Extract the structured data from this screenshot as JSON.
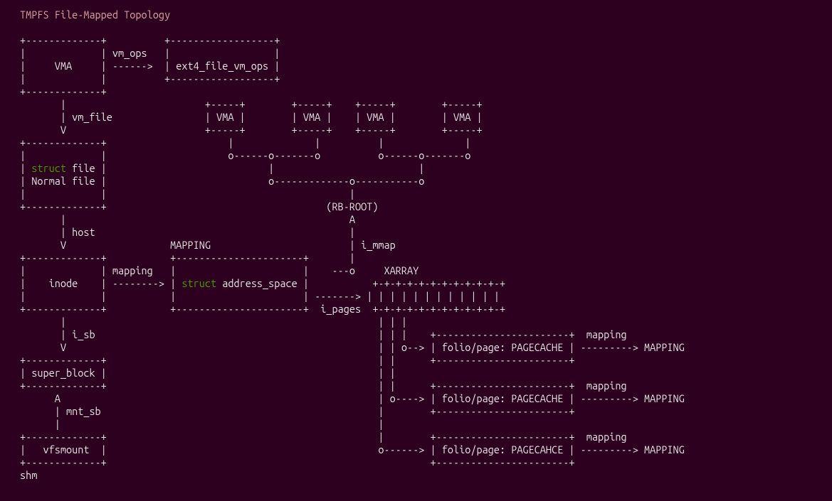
{
  "title": "TMPFS File-Mapped Topology",
  "chart_data": {
    "type": "diagram",
    "title": "TMPFS File-Mapped Topology",
    "nodes": [
      {
        "id": "VMA0",
        "label": "VMA"
      },
      {
        "id": "ext4_file_vm_ops",
        "label": "ext4_file_vm_ops"
      },
      {
        "id": "VMA1",
        "label": "VMA"
      },
      {
        "id": "VMA2",
        "label": "VMA"
      },
      {
        "id": "VMA3",
        "label": "VMA"
      },
      {
        "id": "VMA4",
        "label": "VMA"
      },
      {
        "id": "struct_file",
        "label": "struct file / Normal file"
      },
      {
        "id": "RB_ROOT",
        "label": "(RB-ROOT)"
      },
      {
        "id": "inode",
        "label": "inode"
      },
      {
        "id": "address_space",
        "label": "struct address_space",
        "annotation": "MAPPING"
      },
      {
        "id": "XARRAY",
        "label": "XARRAY"
      },
      {
        "id": "super_block",
        "label": "super_block"
      },
      {
        "id": "vfsmount",
        "label": "vfsmount"
      },
      {
        "id": "shm",
        "label": "shm"
      },
      {
        "id": "folio1",
        "label": "folio/page: PAGECACHE"
      },
      {
        "id": "folio2",
        "label": "folio/page: PAGECACHE"
      },
      {
        "id": "folio3",
        "label": "folio/page: PAGECAHCE"
      }
    ],
    "edges": [
      {
        "from": "VMA0",
        "to": "ext4_file_vm_ops",
        "label": "vm_ops"
      },
      {
        "from": "VMA0",
        "to": "struct_file",
        "label": "vm_file"
      },
      {
        "from": "VMA1",
        "to": "RB_ROOT",
        "label": ""
      },
      {
        "from": "VMA2",
        "to": "RB_ROOT",
        "label": ""
      },
      {
        "from": "VMA3",
        "to": "RB_ROOT",
        "label": ""
      },
      {
        "from": "VMA4",
        "to": "RB_ROOT",
        "label": ""
      },
      {
        "from": "struct_file",
        "to": "inode",
        "label": "host"
      },
      {
        "from": "inode",
        "to": "address_space",
        "label": "mapping"
      },
      {
        "from": "address_space",
        "to": "RB_ROOT",
        "label": "i_mmap"
      },
      {
        "from": "address_space",
        "to": "XARRAY",
        "label": "i_pages"
      },
      {
        "from": "inode",
        "to": "super_block",
        "label": "i_sb"
      },
      {
        "from": "vfsmount",
        "to": "super_block",
        "label": "mnt_sb"
      },
      {
        "from": "XARRAY",
        "to": "folio1",
        "label": ""
      },
      {
        "from": "XARRAY",
        "to": "folio2",
        "label": ""
      },
      {
        "from": "XARRAY",
        "to": "folio3",
        "label": ""
      },
      {
        "from": "folio1",
        "to": "address_space",
        "label": "mapping -> MAPPING"
      },
      {
        "from": "folio2",
        "to": "address_space",
        "label": "mapping -> MAPPING"
      },
      {
        "from": "folio3",
        "to": "address_space",
        "label": "mapping -> MAPPING"
      }
    ],
    "footer": "shm",
    "keyword": "struct"
  },
  "kw": "struct",
  "lines": {
    "l00": "+-------------+          +------------------+",
    "l01": "|             | vm_ops   |                  |",
    "l02a": "|     VMA     | ------>  | ext4_file_vm_ops |",
    "l03": "|             |          +------------------+",
    "l04": "+-------------+",
    "l05": "       |                        +-----+        +-----+    +-----+        +-----+",
    "l06": "       | vm_file                | VMA |        | VMA |    | VMA |        | VMA |",
    "l07": "       V                        +-----+        +-----+    +-----+        +-----+",
    "l08": "+-------------+                     |              |          |              |",
    "l09": "|             |                     o------o-------o          o------o-------o",
    "l10a": " file |                            |                         |",
    "l11": "| Normal file |                            o-------------o-----------o",
    "l12": "|             |                                          |",
    "l13": "+-------------+                                      (RB-ROOT)",
    "l14": "       |                                                 A",
    "l15": "       | host                                            |",
    "l16": "       V                  MAPPING                        | i_mmap",
    "l17": "+-------------+           +----------------------+       |",
    "l18": "|             | mapping   |                      |    ---o     XARRAY",
    "l19a": "|    inode    | --------> | ",
    "l19b": " address_space |           +-+-+-+-+-+-+-+-+-+-+-+",
    "l20": "|             |           |                      | -------> | | | | | | | | | | | |",
    "l21": "+-------------+           +----------------------+  i_pages  +-+-+-+-+-+-+-+-+-+-+-+",
    "l22": "       |                                                      | | |",
    "l23": "       | i_sb                                                 | | |    +-----------------------+  mapping",
    "l24": "       V                                                      | | o--> | folio/page: PAGECACHE | ---------> MAPPING",
    "l25": "+-------------+                                               | |      +-----------------------+",
    "l26": "| super_block |                                               | |",
    "l27": "+-------------+                                               | |      +-----------------------+  mapping",
    "l28": "      A                                                       | o----> | folio/page: PAGECACHE | ---------> MAPPING",
    "l29": "      | mnt_sb                                                |        +-----------------------+",
    "l30": "      |                                                       |",
    "l31": "+-------------+                                               |        +-----------------------+  mapping",
    "l32": "|   vfsmount  |                                               o------> | folio/page: PAGECAHCE | ---------> MAPPING",
    "l33": "+-------------+                                                        +-----------------------+",
    "l34": "shm"
  }
}
